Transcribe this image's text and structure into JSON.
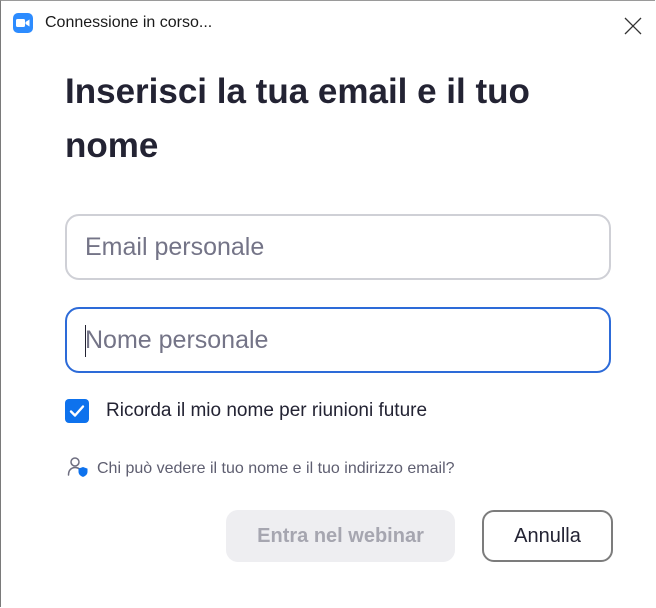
{
  "window": {
    "title": "Connessione in corso...",
    "icon": "zoom-camera-icon",
    "close_icon": "close-icon"
  },
  "dialog": {
    "heading": "Inserisci la tua email e il tuo nome",
    "email_field": {
      "placeholder": "Email personale",
      "value": ""
    },
    "name_field": {
      "placeholder": "Nome personale",
      "value": "",
      "focused": true
    },
    "remember": {
      "label": "Ricorda il mio nome per riunioni future",
      "checked": true
    },
    "privacy": {
      "icon": "user-shield-icon",
      "label": "Chi può vedere il tuo nome e il tuo indirizzo email?"
    },
    "buttons": {
      "join_label": "Entra nel webinar",
      "join_disabled": true,
      "cancel_label": "Annulla"
    }
  },
  "colors": {
    "accent": "#0e72ed",
    "focus_border": "#2d6bd8",
    "heading": "#232333",
    "disabled_bg": "#eeeef1",
    "disabled_text": "#a6a6b0"
  }
}
